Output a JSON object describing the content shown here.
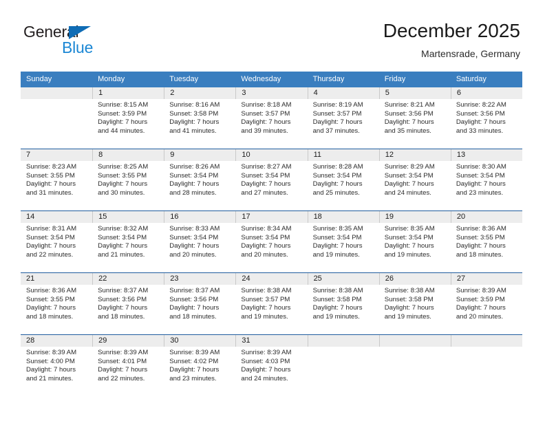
{
  "brand": {
    "word_one": "General",
    "word_two": "Blue",
    "primary_color": "#0f6cb5",
    "accent_color": "#1b87d4"
  },
  "header": {
    "title": "December 2025",
    "subtitle": "Martensrade, Germany"
  },
  "calendar": {
    "header_bg": "#3a7ebf",
    "row_rule_color": "#1f5c9e",
    "daynum_band_bg": "#ededed",
    "weekday_headers": [
      "Sunday",
      "Monday",
      "Tuesday",
      "Wednesday",
      "Thursday",
      "Friday",
      "Saturday"
    ],
    "weeks": [
      [
        {
          "day": "",
          "sunrise": "",
          "sunset": "",
          "daylight_line1": "",
          "daylight_line2": "",
          "empty": true
        },
        {
          "day": "1",
          "sunrise": "Sunrise: 8:15 AM",
          "sunset": "Sunset: 3:59 PM",
          "daylight_line1": "Daylight: 7 hours",
          "daylight_line2": "and 44 minutes."
        },
        {
          "day": "2",
          "sunrise": "Sunrise: 8:16 AM",
          "sunset": "Sunset: 3:58 PM",
          "daylight_line1": "Daylight: 7 hours",
          "daylight_line2": "and 41 minutes."
        },
        {
          "day": "3",
          "sunrise": "Sunrise: 8:18 AM",
          "sunset": "Sunset: 3:57 PM",
          "daylight_line1": "Daylight: 7 hours",
          "daylight_line2": "and 39 minutes."
        },
        {
          "day": "4",
          "sunrise": "Sunrise: 8:19 AM",
          "sunset": "Sunset: 3:57 PM",
          "daylight_line1": "Daylight: 7 hours",
          "daylight_line2": "and 37 minutes."
        },
        {
          "day": "5",
          "sunrise": "Sunrise: 8:21 AM",
          "sunset": "Sunset: 3:56 PM",
          "daylight_line1": "Daylight: 7 hours",
          "daylight_line2": "and 35 minutes."
        },
        {
          "day": "6",
          "sunrise": "Sunrise: 8:22 AM",
          "sunset": "Sunset: 3:56 PM",
          "daylight_line1": "Daylight: 7 hours",
          "daylight_line2": "and 33 minutes."
        }
      ],
      [
        {
          "day": "7",
          "sunrise": "Sunrise: 8:23 AM",
          "sunset": "Sunset: 3:55 PM",
          "daylight_line1": "Daylight: 7 hours",
          "daylight_line2": "and 31 minutes."
        },
        {
          "day": "8",
          "sunrise": "Sunrise: 8:25 AM",
          "sunset": "Sunset: 3:55 PM",
          "daylight_line1": "Daylight: 7 hours",
          "daylight_line2": "and 30 minutes."
        },
        {
          "day": "9",
          "sunrise": "Sunrise: 8:26 AM",
          "sunset": "Sunset: 3:54 PM",
          "daylight_line1": "Daylight: 7 hours",
          "daylight_line2": "and 28 minutes."
        },
        {
          "day": "10",
          "sunrise": "Sunrise: 8:27 AM",
          "sunset": "Sunset: 3:54 PM",
          "daylight_line1": "Daylight: 7 hours",
          "daylight_line2": "and 27 minutes."
        },
        {
          "day": "11",
          "sunrise": "Sunrise: 8:28 AM",
          "sunset": "Sunset: 3:54 PM",
          "daylight_line1": "Daylight: 7 hours",
          "daylight_line2": "and 25 minutes."
        },
        {
          "day": "12",
          "sunrise": "Sunrise: 8:29 AM",
          "sunset": "Sunset: 3:54 PM",
          "daylight_line1": "Daylight: 7 hours",
          "daylight_line2": "and 24 minutes."
        },
        {
          "day": "13",
          "sunrise": "Sunrise: 8:30 AM",
          "sunset": "Sunset: 3:54 PM",
          "daylight_line1": "Daylight: 7 hours",
          "daylight_line2": "and 23 minutes."
        }
      ],
      [
        {
          "day": "14",
          "sunrise": "Sunrise: 8:31 AM",
          "sunset": "Sunset: 3:54 PM",
          "daylight_line1": "Daylight: 7 hours",
          "daylight_line2": "and 22 minutes."
        },
        {
          "day": "15",
          "sunrise": "Sunrise: 8:32 AM",
          "sunset": "Sunset: 3:54 PM",
          "daylight_line1": "Daylight: 7 hours",
          "daylight_line2": "and 21 minutes."
        },
        {
          "day": "16",
          "sunrise": "Sunrise: 8:33 AM",
          "sunset": "Sunset: 3:54 PM",
          "daylight_line1": "Daylight: 7 hours",
          "daylight_line2": "and 20 minutes."
        },
        {
          "day": "17",
          "sunrise": "Sunrise: 8:34 AM",
          "sunset": "Sunset: 3:54 PM",
          "daylight_line1": "Daylight: 7 hours",
          "daylight_line2": "and 20 minutes."
        },
        {
          "day": "18",
          "sunrise": "Sunrise: 8:35 AM",
          "sunset": "Sunset: 3:54 PM",
          "daylight_line1": "Daylight: 7 hours",
          "daylight_line2": "and 19 minutes."
        },
        {
          "day": "19",
          "sunrise": "Sunrise: 8:35 AM",
          "sunset": "Sunset: 3:54 PM",
          "daylight_line1": "Daylight: 7 hours",
          "daylight_line2": "and 19 minutes."
        },
        {
          "day": "20",
          "sunrise": "Sunrise: 8:36 AM",
          "sunset": "Sunset: 3:55 PM",
          "daylight_line1": "Daylight: 7 hours",
          "daylight_line2": "and 18 minutes."
        }
      ],
      [
        {
          "day": "21",
          "sunrise": "Sunrise: 8:36 AM",
          "sunset": "Sunset: 3:55 PM",
          "daylight_line1": "Daylight: 7 hours",
          "daylight_line2": "and 18 minutes."
        },
        {
          "day": "22",
          "sunrise": "Sunrise: 8:37 AM",
          "sunset": "Sunset: 3:56 PM",
          "daylight_line1": "Daylight: 7 hours",
          "daylight_line2": "and 18 minutes."
        },
        {
          "day": "23",
          "sunrise": "Sunrise: 8:37 AM",
          "sunset": "Sunset: 3:56 PM",
          "daylight_line1": "Daylight: 7 hours",
          "daylight_line2": "and 18 minutes."
        },
        {
          "day": "24",
          "sunrise": "Sunrise: 8:38 AM",
          "sunset": "Sunset: 3:57 PM",
          "daylight_line1": "Daylight: 7 hours",
          "daylight_line2": "and 19 minutes."
        },
        {
          "day": "25",
          "sunrise": "Sunrise: 8:38 AM",
          "sunset": "Sunset: 3:58 PM",
          "daylight_line1": "Daylight: 7 hours",
          "daylight_line2": "and 19 minutes."
        },
        {
          "day": "26",
          "sunrise": "Sunrise: 8:38 AM",
          "sunset": "Sunset: 3:58 PM",
          "daylight_line1": "Daylight: 7 hours",
          "daylight_line2": "and 19 minutes."
        },
        {
          "day": "27",
          "sunrise": "Sunrise: 8:39 AM",
          "sunset": "Sunset: 3:59 PM",
          "daylight_line1": "Daylight: 7 hours",
          "daylight_line2": "and 20 minutes."
        }
      ],
      [
        {
          "day": "28",
          "sunrise": "Sunrise: 8:39 AM",
          "sunset": "Sunset: 4:00 PM",
          "daylight_line1": "Daylight: 7 hours",
          "daylight_line2": "and 21 minutes."
        },
        {
          "day": "29",
          "sunrise": "Sunrise: 8:39 AM",
          "sunset": "Sunset: 4:01 PM",
          "daylight_line1": "Daylight: 7 hours",
          "daylight_line2": "and 22 minutes."
        },
        {
          "day": "30",
          "sunrise": "Sunrise: 8:39 AM",
          "sunset": "Sunset: 4:02 PM",
          "daylight_line1": "Daylight: 7 hours",
          "daylight_line2": "and 23 minutes."
        },
        {
          "day": "31",
          "sunrise": "Sunrise: 8:39 AM",
          "sunset": "Sunset: 4:03 PM",
          "daylight_line1": "Daylight: 7 hours",
          "daylight_line2": "and 24 minutes."
        },
        {
          "day": "",
          "sunrise": "",
          "sunset": "",
          "daylight_line1": "",
          "daylight_line2": "",
          "empty": true
        },
        {
          "day": "",
          "sunrise": "",
          "sunset": "",
          "daylight_line1": "",
          "daylight_line2": "",
          "empty": true
        },
        {
          "day": "",
          "sunrise": "",
          "sunset": "",
          "daylight_line1": "",
          "daylight_line2": "",
          "empty": true
        }
      ]
    ]
  }
}
